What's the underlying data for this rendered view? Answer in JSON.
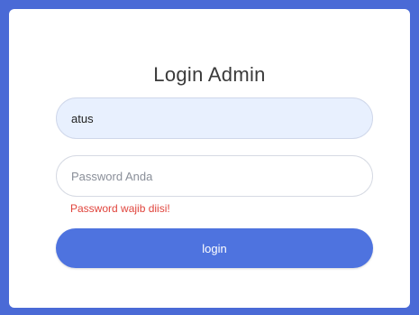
{
  "login": {
    "title": "Login Admin",
    "username_value": "atus",
    "password_placeholder": "Password Anda",
    "password_error": "Password wajib diisi!",
    "submit_label": "login"
  },
  "colors": {
    "page_background": "#4a6ad6",
    "button": "#4e73df",
    "error": "#e0443c",
    "autofill": "#e8f0fe"
  }
}
